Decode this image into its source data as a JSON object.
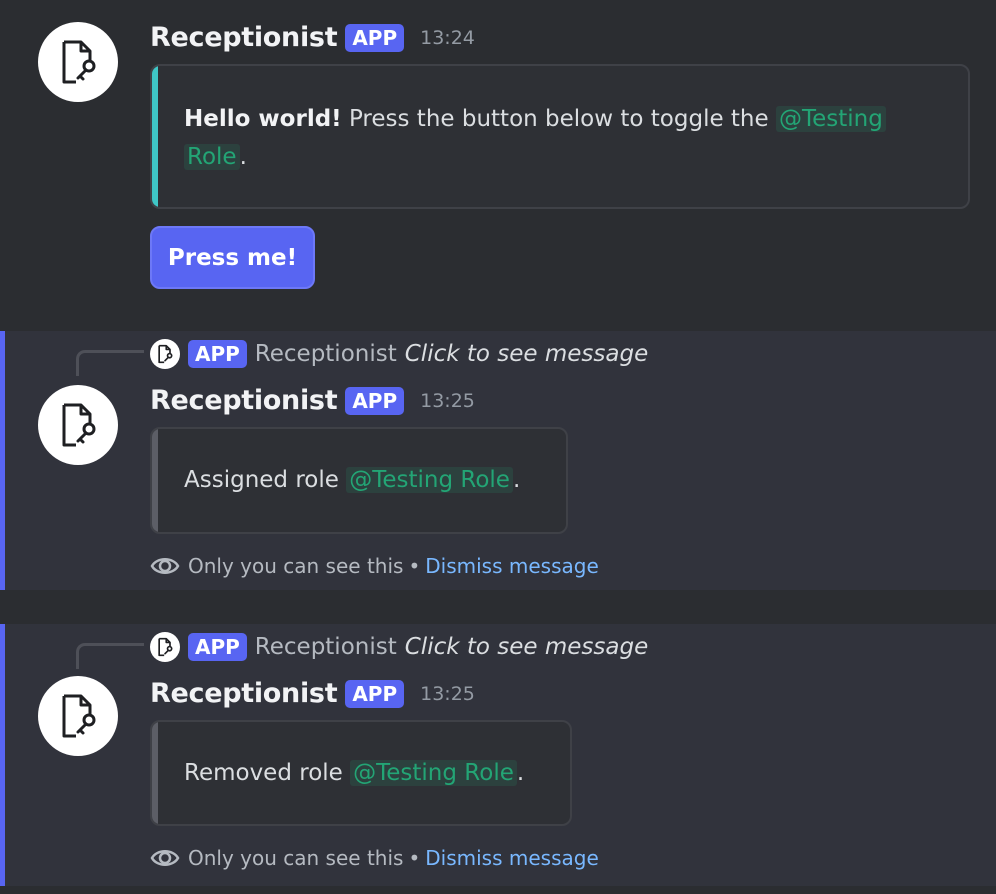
{
  "messages": [
    {
      "author": "Receptionist",
      "badge": "APP",
      "time": "13:24",
      "embed": {
        "bold": "Hello world!",
        "text": " Press the button below to toggle the ",
        "mention_line1": "@Testing",
        "mention_line2": "Role",
        "suffix": "."
      },
      "button_label": "Press me!"
    },
    {
      "reply": {
        "badge": "APP",
        "author": "Receptionist",
        "preview": "Click to see message"
      },
      "author": "Receptionist",
      "badge": "APP",
      "time": "13:25",
      "embed": {
        "text": "Assigned role ",
        "mention": "@Testing Role",
        "suffix": "."
      },
      "note": {
        "text": "Only you can see this",
        "separator": "•",
        "dismiss": "Dismiss message"
      }
    },
    {
      "reply": {
        "badge": "APP",
        "author": "Receptionist",
        "preview": "Click to see message"
      },
      "author": "Receptionist",
      "badge": "APP",
      "time": "13:25",
      "embed": {
        "text": "Removed role ",
        "mention": "@Testing Role",
        "suffix": "."
      },
      "note": {
        "text": "Only you can see this",
        "separator": "•",
        "dismiss": "Dismiss message"
      }
    }
  ],
  "colors": {
    "background": "#2b2d31",
    "ephemeral_background": "#31333c",
    "blurple": "#5865f2",
    "embed_accent_first": "#3fc6c6",
    "embed_accent_default": "#5c5e66",
    "mention": "#23a575",
    "link": "#79b8ff"
  },
  "icons": {
    "avatar": "document-key-icon",
    "ephemeral": "eye-icon"
  }
}
